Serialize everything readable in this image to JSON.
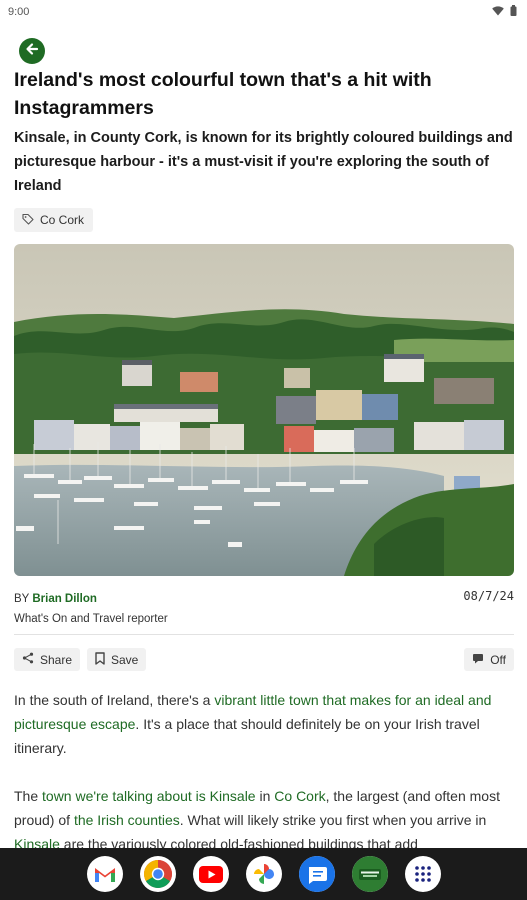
{
  "status": {
    "time": "9:00"
  },
  "article": {
    "headline": "Ireland's most colourful town that's a hit with Instagrammers",
    "standfirst": "Kinsale, in County Cork, is known for its brightly coloured buildings and picturesque harbour - it's a must-visit if you're exploring the south of Ireland",
    "tag": "Co Cork",
    "by_prefix": "BY",
    "author": "Brian Dillon",
    "author_role": "What's On and Travel reporter",
    "date": "08/7/24"
  },
  "actions": {
    "share": "Share",
    "save": "Save",
    "toggle": "Off"
  },
  "body": {
    "p1": {
      "t1": "In the south of Ireland, there's a ",
      "link1": "vibrant little town that makes for an ideal and picturesque escape",
      "t2": ". It's a place that should definitely be on your Irish travel itinerary."
    },
    "p2": {
      "t1": "The ",
      "link1": "town we're talking about is Kinsale",
      "t2": " in ",
      "link2": "Co Cork",
      "t3": ", the largest (and often most proud) of ",
      "link3": "the Irish counties",
      "t4": ". What will likely strike you first when you arrive in ",
      "link4": "Kinsale",
      "t5": " are the variously colored old-fashioned buildings that add"
    }
  },
  "dock_apps": [
    "gmail-icon",
    "chrome-icon",
    "youtube-icon",
    "photos-icon",
    "messages-icon",
    "news-app-icon",
    "app-drawer-icon"
  ],
  "colors": {
    "accent": "#1f6b24",
    "dock": "#1b1b1b"
  }
}
